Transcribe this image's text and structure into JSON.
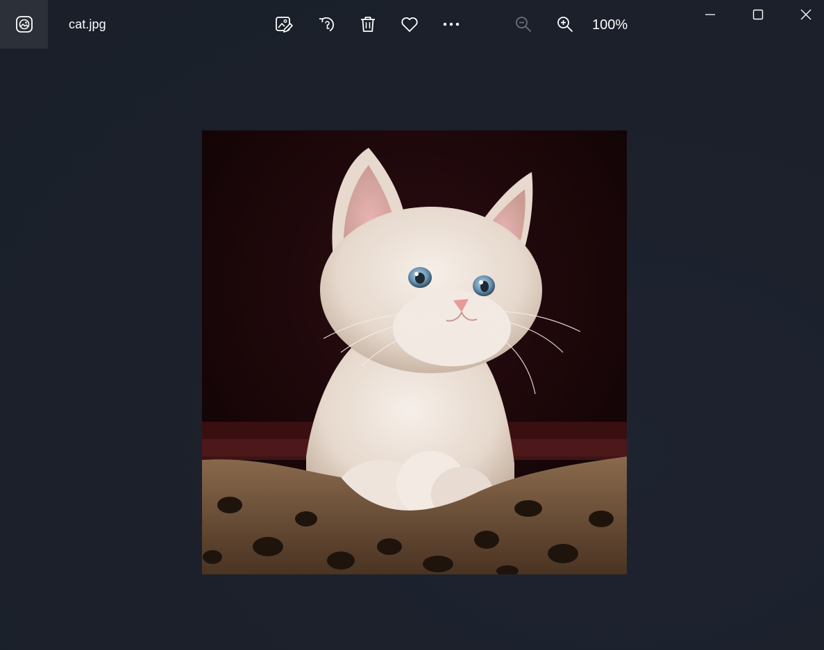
{
  "window": {
    "file_name": "cat.jpg",
    "zoom_level": "100%"
  },
  "toolbar": {
    "tools": [
      {
        "name": "edit-image",
        "icon": "edit-image-icon"
      },
      {
        "name": "rotate",
        "icon": "rotate-icon"
      },
      {
        "name": "delete",
        "icon": "trash-icon"
      },
      {
        "name": "favorite",
        "icon": "heart-icon"
      },
      {
        "name": "more",
        "icon": "more-icon"
      },
      {
        "name": "zoom-out",
        "icon": "zoom-out-icon",
        "enabled": false
      },
      {
        "name": "zoom-in",
        "icon": "zoom-in-icon",
        "enabled": true
      }
    ]
  },
  "window_controls": [
    "minimize-icon",
    "maximize-icon",
    "close-icon"
  ],
  "colors": {
    "background": "#1b202a",
    "titlebar_icon_bg": "#2b3039",
    "icon": "#ffffff",
    "disabled_icon": "#6b7079"
  }
}
